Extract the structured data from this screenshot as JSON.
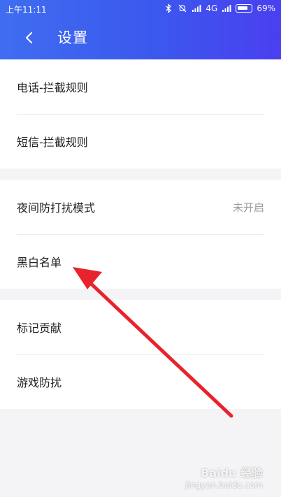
{
  "status_bar": {
    "time": "上午11:11",
    "network": "4G",
    "battery": "69%"
  },
  "header": {
    "title": "设置"
  },
  "groups": [
    {
      "items": [
        {
          "label": "电话-拦截规则"
        },
        {
          "label": "短信-拦截规则"
        }
      ]
    },
    {
      "items": [
        {
          "label": "夜间防打扰模式",
          "value": "未开启"
        },
        {
          "label": "黑白名单"
        }
      ]
    },
    {
      "items": [
        {
          "label": "标记贡献"
        },
        {
          "label": "游戏防扰"
        }
      ]
    }
  ],
  "annotation": {
    "arrow_color": "#e8232b"
  },
  "watermark": {
    "brand": "Baidu 经验",
    "url": "jingyan.baidu.com"
  }
}
